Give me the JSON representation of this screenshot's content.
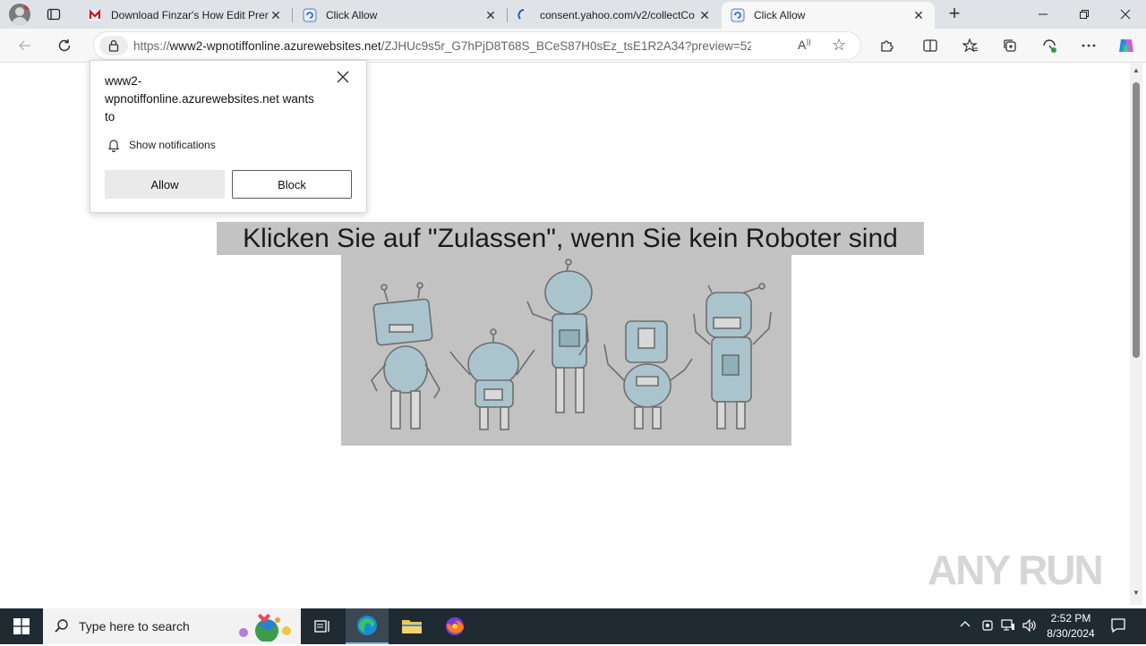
{
  "tabs": [
    {
      "title": "Download Finzar's How Edit Prem",
      "favicon": "mega-logo-icon",
      "active": false
    },
    {
      "title": "Click Allow",
      "favicon": "loading-page-icon",
      "active": false
    },
    {
      "title": "consent.yahoo.com/v2/collectCo",
      "favicon": "loading-spinner-icon",
      "active": false
    },
    {
      "title": "Click Allow",
      "favicon": "loading-page-icon",
      "active": true
    }
  ],
  "address": {
    "scheme": "https://",
    "host": "www2-wpnotiffonline.azurewebsites.net",
    "path": "/ZJHUc9s5r_G7hPjD8T68S_BCeS87H0sEz_tsE1R2A34?preview=5299&..."
  },
  "permission": {
    "site_line1": "www2-",
    "site_line2": "wpnotiffonline.azurewebsites.net wants",
    "site_line3": "to",
    "request": "Show notifications",
    "allow_label": "Allow",
    "block_label": "Block"
  },
  "page": {
    "headline": "Klicken Sie auf \"Zulassen\", wenn Sie kein Roboter sind"
  },
  "watermark": "ANY RUN",
  "taskbar": {
    "search_placeholder": "Type here to search",
    "time": "2:52 PM",
    "date": "8/30/2024"
  },
  "colors": {
    "tabstrip": "#dfe3e7",
    "taskbar": "#1f2a33",
    "headline_bg": "#c3c3c3",
    "image_bg": "#c2c2c2",
    "robot_fill": "#a9c4cc"
  }
}
